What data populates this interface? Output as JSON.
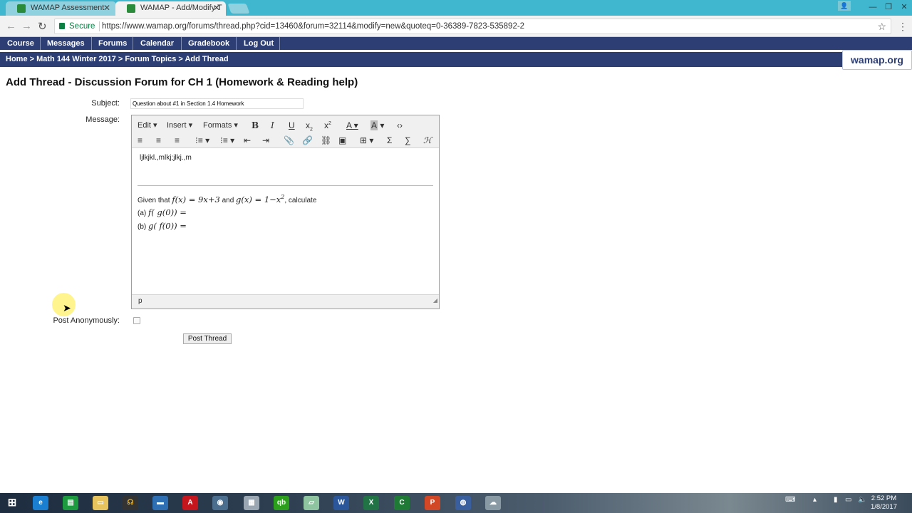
{
  "browser": {
    "tabs": [
      {
        "title": "WAMAP Assessment",
        "active": false
      },
      {
        "title": "WAMAP - Add/Modify T",
        "active": true
      }
    ],
    "secure_label": "Secure",
    "url": "https://www.wamap.org/forums/thread.php?cid=13460&forum=32114&modify=new&quoteq=0-36389-7823-535892-2"
  },
  "nav": {
    "items": [
      "Course",
      "Messages",
      "Forums",
      "Calendar",
      "Gradebook",
      "Log Out"
    ]
  },
  "breadcrumb": "Home > Math 144 Winter 2017 > Forum Topics > Add Thread",
  "logo_text": "wamap.org",
  "page": {
    "title": "Add Thread - Discussion Forum for CH 1 (Homework & Reading help)",
    "subject_label": "Subject:",
    "subject_value": "Question about #1 in Section 1.4 Homework",
    "message_label": "Message:",
    "anon_label": "Post Anonymously:",
    "post_button": "Post Thread"
  },
  "editor": {
    "menus": [
      "Edit",
      "Insert",
      "Formats"
    ],
    "body_line": "ljlkjkl.,mlkj;jlkj.,m",
    "given_prefix": "Given that",
    "f_expr": "f(x) = 9x+3",
    "and": "and",
    "g_expr": "g(x) = 1−x",
    "g_exp": "2",
    "calc": ", calculate",
    "part_a_label": "(a)",
    "part_a": "f( g(0)) =",
    "part_b_label": "(b)",
    "part_b": "g( f(0)) =",
    "status_path": "p"
  },
  "taskbar": {
    "time": "2:52 PM",
    "date": "1/8/2017"
  },
  "colors": {
    "nav_bg": "#2c3e74",
    "tab_bar": "#41b7cf",
    "secure_green": "#0b8043"
  }
}
